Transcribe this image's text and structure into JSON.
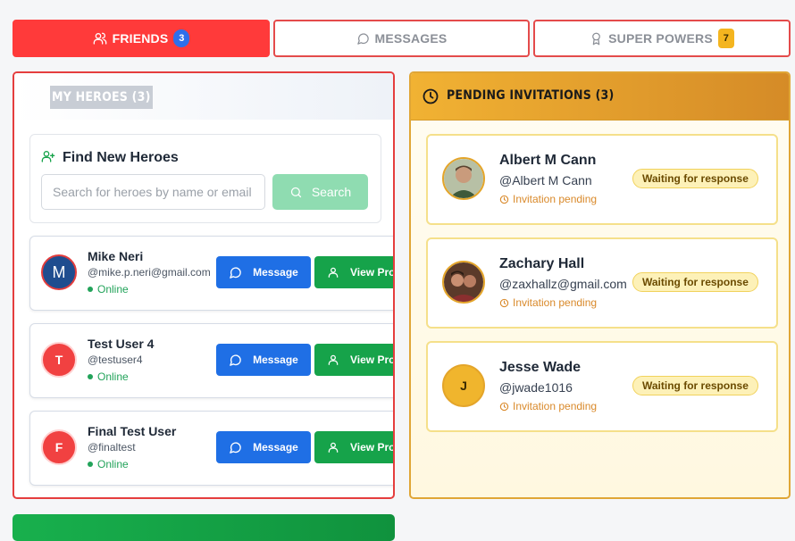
{
  "tabs": {
    "friends": {
      "label": "FRIENDS",
      "count": "3"
    },
    "messages": {
      "label": "MESSAGES"
    },
    "super_powers": {
      "label": "SUPER POWERS",
      "count": "7"
    }
  },
  "heroes": {
    "title": "MY HEROES (3)",
    "find": {
      "title": "Find New Heroes",
      "placeholder": "Search for heroes by name or email",
      "search_label": "Search"
    },
    "friends": [
      {
        "initial": "M",
        "name": "Mike Neri",
        "handle": "@mike.p.neri@gmail.com",
        "status": "Online"
      },
      {
        "initial": "T",
        "name": "Test User 4",
        "handle": "@testuser4",
        "status": "Online"
      },
      {
        "initial": "F",
        "name": "Final Test User",
        "handle": "@finaltest",
        "status": "Online"
      }
    ],
    "message_label": "Message",
    "profile_label": "View Profile"
  },
  "pending": {
    "title": "PENDING INVITATIONS (3)",
    "invites": [
      {
        "name": "Albert M Cann",
        "handle": "@Albert M Cann",
        "status": "Invitation pending",
        "badge": "Waiting for response"
      },
      {
        "name": "Zachary Hall",
        "handle": "@zaxhallz@gmail.com",
        "status": "Invitation pending",
        "badge": "Waiting for response"
      },
      {
        "initial": "J",
        "name": "Jesse Wade",
        "handle": "@jwade1016",
        "status": "Invitation pending",
        "badge": "Waiting for response"
      }
    ]
  },
  "colors": {
    "accent_red": "#ff3a3a",
    "accent_gold": "#f1b233",
    "message_blue": "#1f6fe5",
    "profile_green": "#16a34a"
  }
}
